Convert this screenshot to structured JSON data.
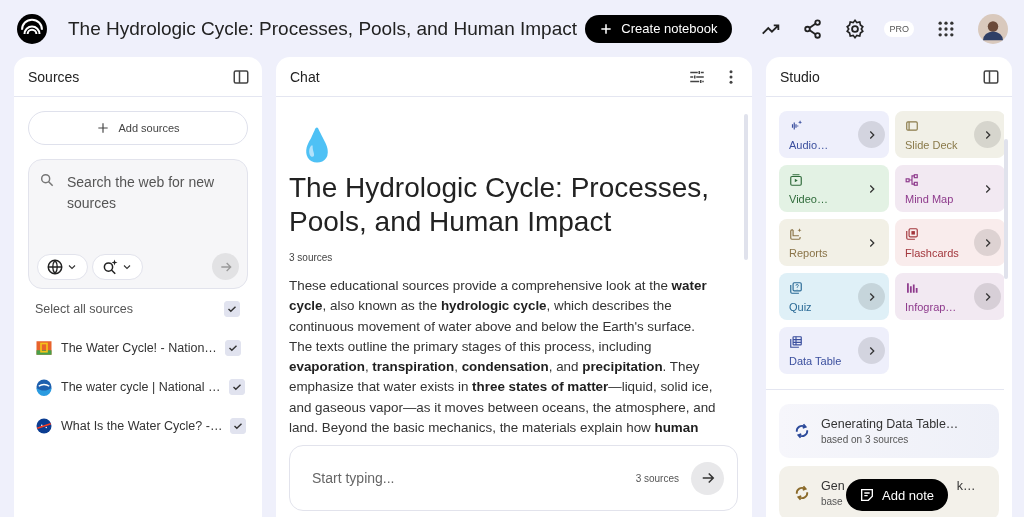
{
  "app_bar": {
    "title": "The Hydrologic Cycle: Processes, Pools, and Human Impact",
    "create_button": "Create notebook",
    "plan_badge": "PRO"
  },
  "sources": {
    "title": "Sources",
    "add_button": "Add sources",
    "search": {
      "placeholder": "Search the web for new sources"
    },
    "select_all": {
      "label": "Select all sources",
      "checked": true
    },
    "items": [
      {
        "kind": "orange",
        "title": "The Water Cycle! - Nation…",
        "checked": true
      },
      {
        "kind": "noaa",
        "title": "The water cycle | National …",
        "checked": true
      },
      {
        "kind": "nasa",
        "title": "What Is the Water Cycle? -…",
        "checked": true
      }
    ]
  },
  "chat": {
    "title": "Chat",
    "emoji": "💧",
    "heading": "The Hydrologic Cycle: Processes, Pools, and Human Impact",
    "source_count": "3 sources",
    "summary": "These educational sources provide a comprehensive look at the **water cycle**, also known as the **hydrologic cycle**, which describes the continuous movement of water above and below the Earth's surface. The texts outline the primary stages of this process, including **evaporation**, **transpiration**, **condensation**, and **precipitation**. They emphasize that water exists in **three states of matter**—liquid, solid ice, and gaseous vapor—as it moves between oceans, the atmosphere, and land. Beyond the basic mechanics, the materials explain how **human**",
    "input": {
      "placeholder": "Start typing...",
      "source_count": "3 sources"
    }
  },
  "studio": {
    "title": "Studio",
    "tools": [
      {
        "kind": "audio",
        "label": "Audio…",
        "color": "#3b4f9e",
        "circled": true
      },
      {
        "kind": "slides",
        "label": "Slide Deck",
        "color": "#8a7a4a",
        "circled": true
      },
      {
        "kind": "video",
        "label": "Video…",
        "color": "#2f6b3a",
        "circled": false
      },
      {
        "kind": "mindmap",
        "label": "Mind Map",
        "color": "#8e3a8c",
        "circled": false
      },
      {
        "kind": "reports",
        "label": "Reports",
        "color": "#8a7448",
        "circled": false
      },
      {
        "kind": "flashcards",
        "label": "Flashcards",
        "color": "#a3373d",
        "circled": true
      },
      {
        "kind": "quiz",
        "label": "Quiz",
        "color": "#2a6a96",
        "circled": true
      },
      {
        "kind": "infographic",
        "label": "Infograp…",
        "color": "#8e3a8c",
        "circled": true
      },
      {
        "kind": "table",
        "label": "Data Table",
        "color": "#3b4f9e",
        "circled": true
      }
    ],
    "jobs": [
      {
        "title": "Generating Data Table…",
        "subtitle": "based on 3 sources",
        "color": "#2c4a9a"
      },
      {
        "title": "Gen",
        "title_end": "k…",
        "subtitle": "base",
        "color": "#8a6a2a"
      }
    ],
    "add_note": "Add note"
  }
}
